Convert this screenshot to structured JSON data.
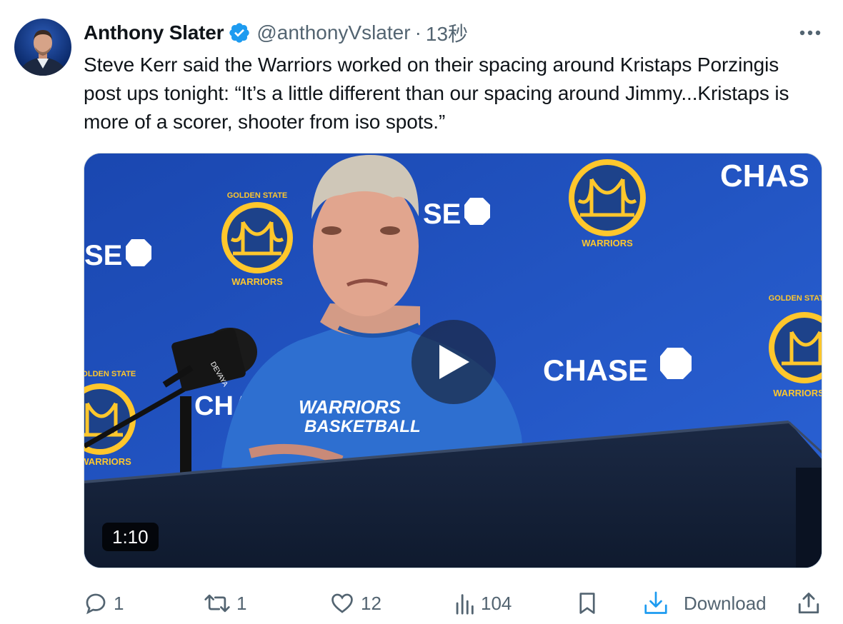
{
  "author": {
    "display_name": "Anthony Slater",
    "handle": "@anthonyVslater",
    "separator": "·",
    "time": "13秒"
  },
  "tweet": {
    "text": "Steve Kerr said the Warriors worked on their spacing around Kristaps Porzingis post ups tonight: “It’s a little different than our spacing around Jimmy...Kristaps is more of a scorer, shooter from iso spots.”"
  },
  "media": {
    "duration": "1:10",
    "backdrop_texts": [
      "CHAS",
      "SE",
      "SE",
      "CHASE",
      "CHA"
    ],
    "logo_texts": [
      "GOLDEN STATE",
      "WARRIORS"
    ],
    "shirt_lines": [
      "WARRIORS",
      "BASKETBALL"
    ],
    "mic_brand": "DEVAYA"
  },
  "actions": {
    "reply_count": "1",
    "repost_count": "1",
    "like_count": "12",
    "views_count": "104",
    "download_label": "Download"
  },
  "colors": {
    "brand_blue": "#1d9bf0",
    "text_primary": "#0f1419",
    "text_secondary": "#536471",
    "warriors_blue": "#1d428a",
    "warriors_gold": "#ffc72c"
  },
  "icons": [
    "verified-badge-icon",
    "more-icon",
    "play-icon",
    "reply-icon",
    "repost-icon",
    "like-icon",
    "views-icon",
    "bookmark-icon",
    "download-icon",
    "share-icon"
  ]
}
